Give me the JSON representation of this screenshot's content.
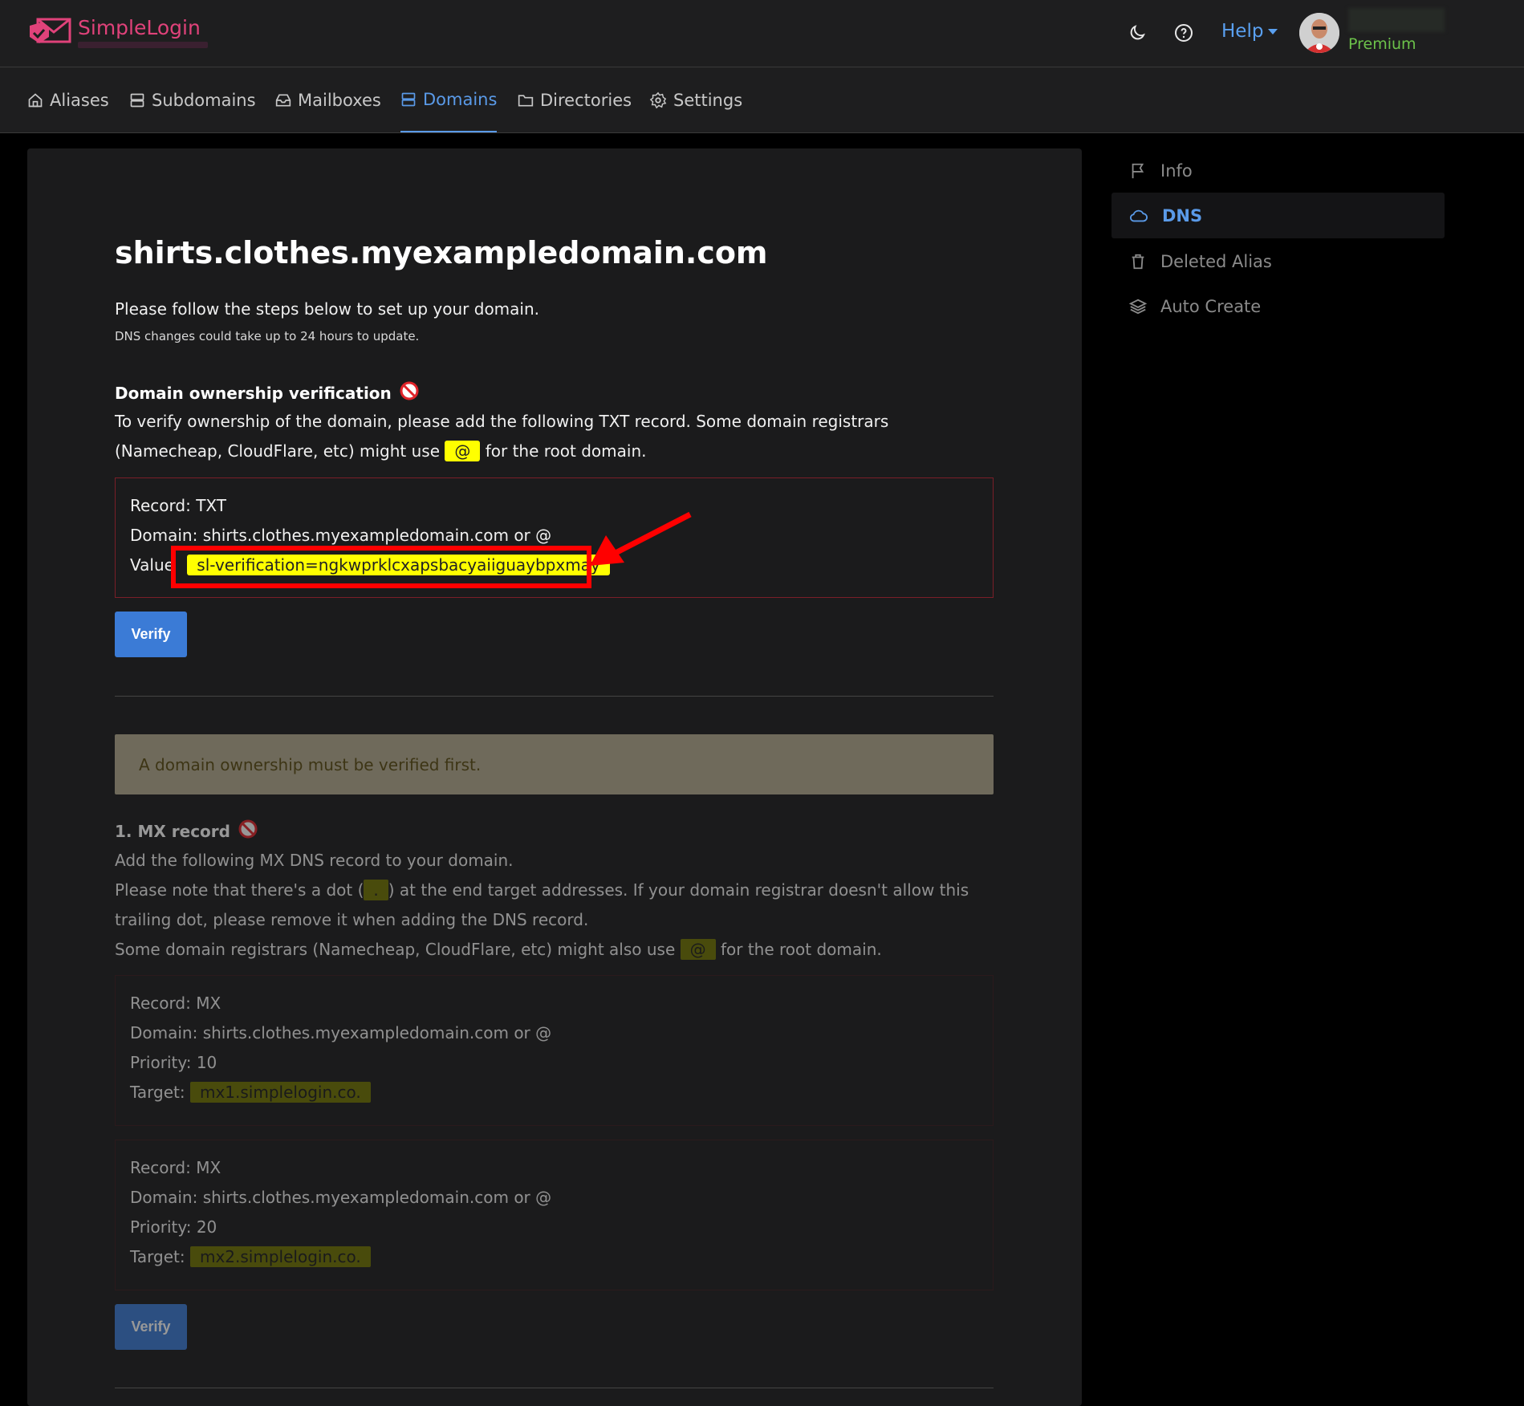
{
  "header": {
    "logo_text": "SimpleLogin",
    "help_label": "Help",
    "plan_label": "Premium",
    "theme_icon": "moon-icon",
    "help_icon": "question-circle-icon"
  },
  "nav": {
    "items": [
      {
        "label": "Aliases",
        "icon": "home-icon"
      },
      {
        "label": "Subdomains",
        "icon": "server-icon"
      },
      {
        "label": "Mailboxes",
        "icon": "inbox-icon"
      },
      {
        "label": "Domains",
        "icon": "server-icon",
        "active": true
      },
      {
        "label": "Directories",
        "icon": "folder-icon"
      },
      {
        "label": "Settings",
        "icon": "gear-icon"
      }
    ]
  },
  "main": {
    "title": "shirts.clothes.myexampledomain.com",
    "intro": "Please follow the steps below to set up your domain.",
    "intro_small": "DNS changes could take up to 24 hours to update.",
    "ownership": {
      "title": "Domain ownership verification",
      "desc_1": "To verify ownership of the domain, please add the following TXT record. Some domain registrars (Namecheap, CloudFlare, etc) might use",
      "at_symbol": "@",
      "desc_2": "for the root domain.",
      "record": "Record: TXT",
      "domain": "Domain: shirts.clothes.myexampledomain.com or @",
      "value_label": "Value",
      "value": "sl-verification=ngkwprklcxapsbacyaiiguaybpxmay",
      "verify_label": "Verify"
    },
    "alert": "A domain ownership must be verified first.",
    "mx": {
      "title": "1. MX record",
      "line1": "Add the following MX DNS record to your domain.",
      "line2a": "Please note that there's a dot (",
      "dot": ".",
      "line2b": ") at the end target addresses. If your domain registrar doesn't allow this trailing dot, please remove it when adding the DNS record.",
      "line3a": "Some domain registrars (Namecheap, CloudFlare, etc) might also use",
      "at_symbol": "@",
      "line3b": "for the root domain.",
      "records": [
        {
          "record": "Record: MX",
          "domain": "Domain: shirts.clothes.myexampledomain.com or @",
          "priority": "Priority: 10",
          "target_label": "Target:",
          "target": "mx1.simplelogin.co."
        },
        {
          "record": "Record: MX",
          "domain": "Domain: shirts.clothes.myexampledomain.com or @",
          "priority": "Priority: 20",
          "target_label": "Target:",
          "target": "mx2.simplelogin.co."
        }
      ],
      "verify_label": "Verify"
    }
  },
  "sidebar": {
    "items": [
      {
        "label": "Info",
        "icon": "flag-icon"
      },
      {
        "label": "DNS",
        "icon": "cloud-icon",
        "active": true
      },
      {
        "label": "Deleted Alias",
        "icon": "trash-icon"
      },
      {
        "label": "Auto Create",
        "icon": "layers-icon"
      }
    ]
  },
  "colors": {
    "accent": "#5a9ae8",
    "highlight": "#ffff00",
    "annotation": "#ff0000",
    "premium": "#6cc24a"
  }
}
